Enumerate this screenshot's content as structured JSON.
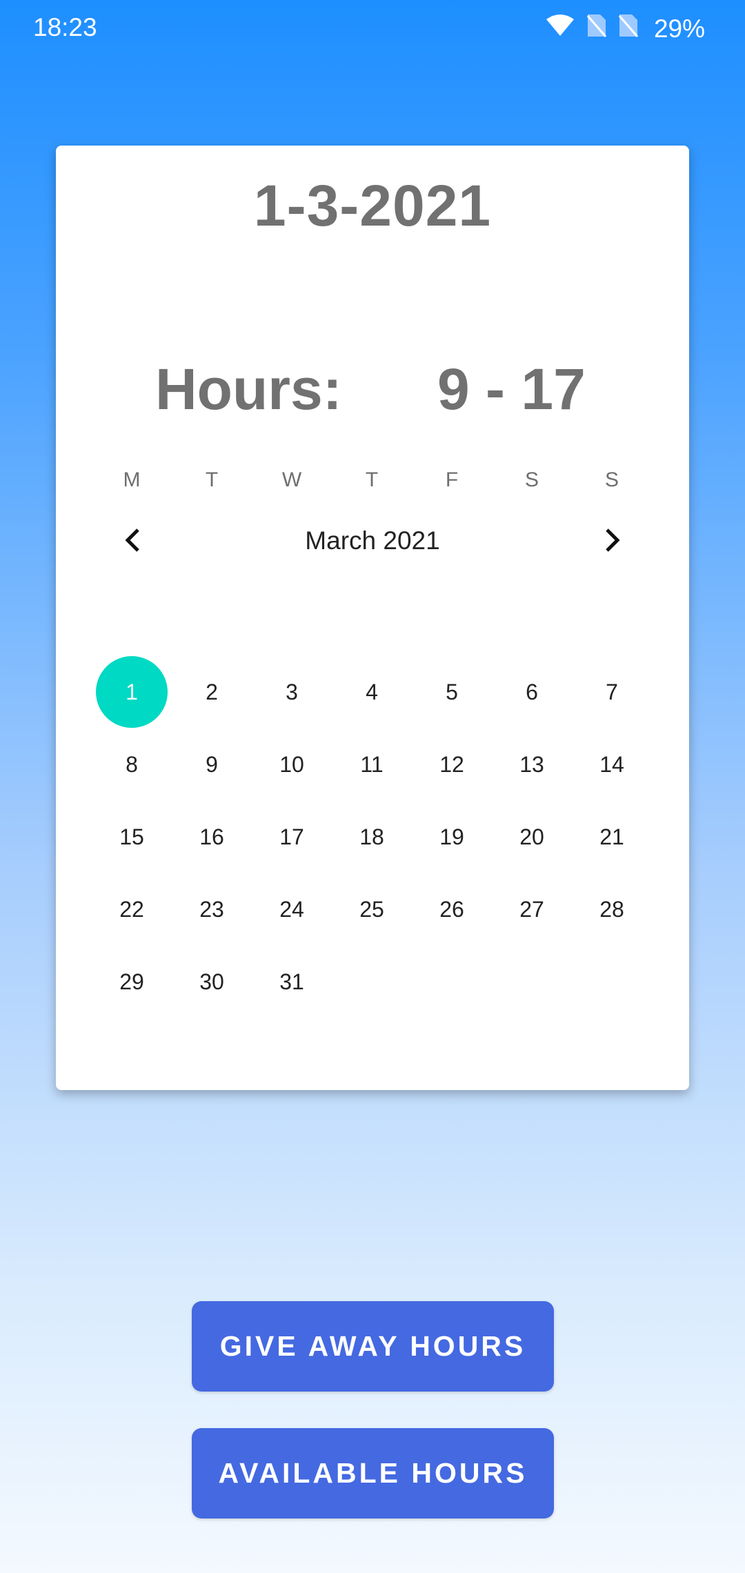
{
  "status_bar": {
    "time": "18:23",
    "battery": "29%",
    "icons": [
      "wifi-icon",
      "no-sim-icon",
      "no-sim-icon"
    ]
  },
  "card": {
    "date": "1-3-2021",
    "hours_label": "Hours:",
    "hours_value": "9 - 17"
  },
  "calendar": {
    "month": "March 2021",
    "weekdays": [
      "M",
      "T",
      "W",
      "T",
      "F",
      "S",
      "S"
    ],
    "selected_day": "1",
    "weeks": [
      [
        "1",
        "2",
        "3",
        "4",
        "5",
        "6",
        "7"
      ],
      [
        "8",
        "9",
        "10",
        "11",
        "12",
        "13",
        "14"
      ],
      [
        "15",
        "16",
        "17",
        "18",
        "19",
        "20",
        "21"
      ],
      [
        "22",
        "23",
        "24",
        "25",
        "26",
        "27",
        "28"
      ],
      [
        "29",
        "30",
        "31"
      ]
    ],
    "selected_color": "#00d9c3"
  },
  "buttons": {
    "give_away": "GIVE AWAY HOURS",
    "available": "AVAILABLE HOURS"
  },
  "colors": {
    "button": "#4469e1",
    "header_blue": "#1e8fff"
  }
}
